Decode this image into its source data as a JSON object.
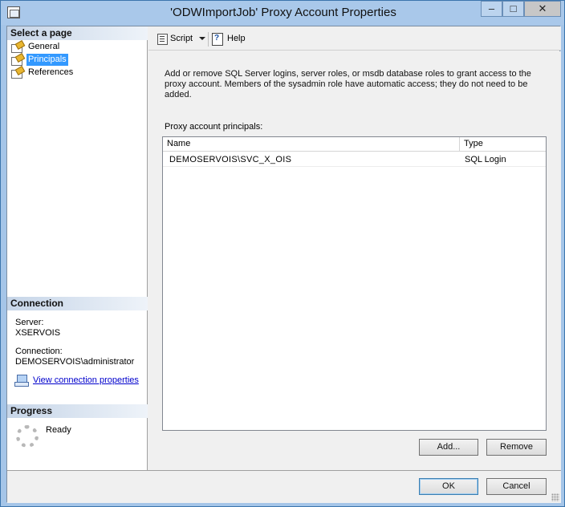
{
  "window": {
    "title": "'ODWImportJob' Proxy Account Properties",
    "buttons": {
      "minimize": "–",
      "maximize": "□",
      "close": "✕"
    }
  },
  "left_pane": {
    "select_page_header": "Select a page",
    "pages": [
      {
        "label": "General",
        "icon": "properties-page-icon",
        "selected": false
      },
      {
        "label": "Principals",
        "icon": "properties-page-icon",
        "selected": true
      },
      {
        "label": "References",
        "icon": "properties-page-icon",
        "selected": false
      }
    ],
    "connection": {
      "header": "Connection",
      "server_label": "Server:",
      "server_value": "XSERVOIS",
      "connection_label": "Connection:",
      "connection_value": "DEMOSERVOIS\\administrator",
      "view_link": "View connection properties"
    },
    "progress": {
      "header": "Progress",
      "status": "Ready"
    }
  },
  "toolbar": {
    "script_label": "Script",
    "help_label": "Help"
  },
  "main": {
    "description": "Add or remove SQL Server logins, server roles, or msdb database roles to grant access to the proxy account. Members of the sysadmin role have automatic access; they do not need to be added.",
    "grid_label": "Proxy account principals:",
    "columns": {
      "name": "Name",
      "type": "Type"
    },
    "rows": [
      {
        "name": "DEMOSERVOIS\\SVC_X_OIS",
        "type": "SQL Login"
      }
    ],
    "add_button": "Add...",
    "remove_button": "Remove"
  },
  "footer": {
    "ok_button": "OK",
    "cancel_button": "Cancel"
  },
  "colors": {
    "title_bar": "#a9c8ea",
    "selection": "#3399ff",
    "link": "#0000cc"
  }
}
